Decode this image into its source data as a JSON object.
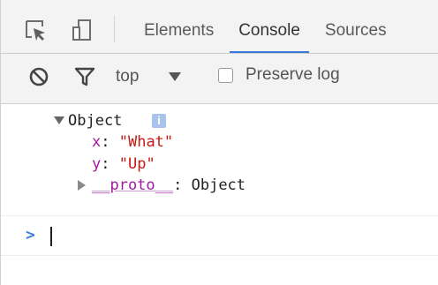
{
  "tabs": [
    {
      "label": "Elements",
      "active": false
    },
    {
      "label": "Console",
      "active": true
    },
    {
      "label": "Sources",
      "active": false
    }
  ],
  "toolbar": {
    "context_value": "top",
    "preserve_log_label": "Preserve log",
    "preserve_log_checked": false
  },
  "console": {
    "object_label": "Object",
    "info_badge": "i",
    "properties": [
      {
        "key": "x",
        "value": "\"What\""
      },
      {
        "key": "y",
        "value": "\"Up\""
      }
    ],
    "proto_key": "__proto__",
    "proto_value": "Object",
    "prompt_symbol": ">"
  },
  "colors": {
    "accent": "#3879d9",
    "key": "#a01aa0",
    "string": "#c41a16"
  },
  "icons": [
    "inspect-element-icon",
    "device-toggle-icon",
    "clear-console-icon",
    "filter-icon",
    "dropdown-arrow-icon",
    "info-icon",
    "expand-triangle-icon",
    "collapse-triangle-icon",
    "prompt-chevron-icon"
  ]
}
